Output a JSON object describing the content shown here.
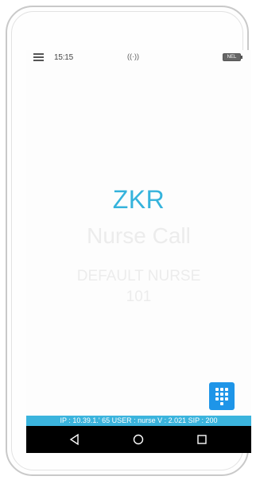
{
  "status_bar": {
    "time": "15:15",
    "signal": "((·))",
    "battery": "NEL",
    "icons": [
      "menu-icon",
      "wireless-icon",
      "battery-icon"
    ]
  },
  "main": {
    "brand": "ZKR",
    "app_title": "Nurse Call",
    "nurse_name": "DEFAULT NURSE",
    "nurse_number": "101",
    "dialpad_icon": "dialpad-icon"
  },
  "info_bar": {
    "text": "IP : 10.39.1.' 65 USER : nurse V : 2.021 SIP : 200"
  },
  "nav_bar": {
    "icons": [
      "back-icon",
      "home-icon",
      "recent-apps-icon"
    ]
  },
  "colors": {
    "accent": "#35b3dc",
    "info_bar": "#3bb4dd",
    "dialpad_button": "#1e95e8",
    "nav_bar": "#000000",
    "faded_text": "#ececec"
  }
}
